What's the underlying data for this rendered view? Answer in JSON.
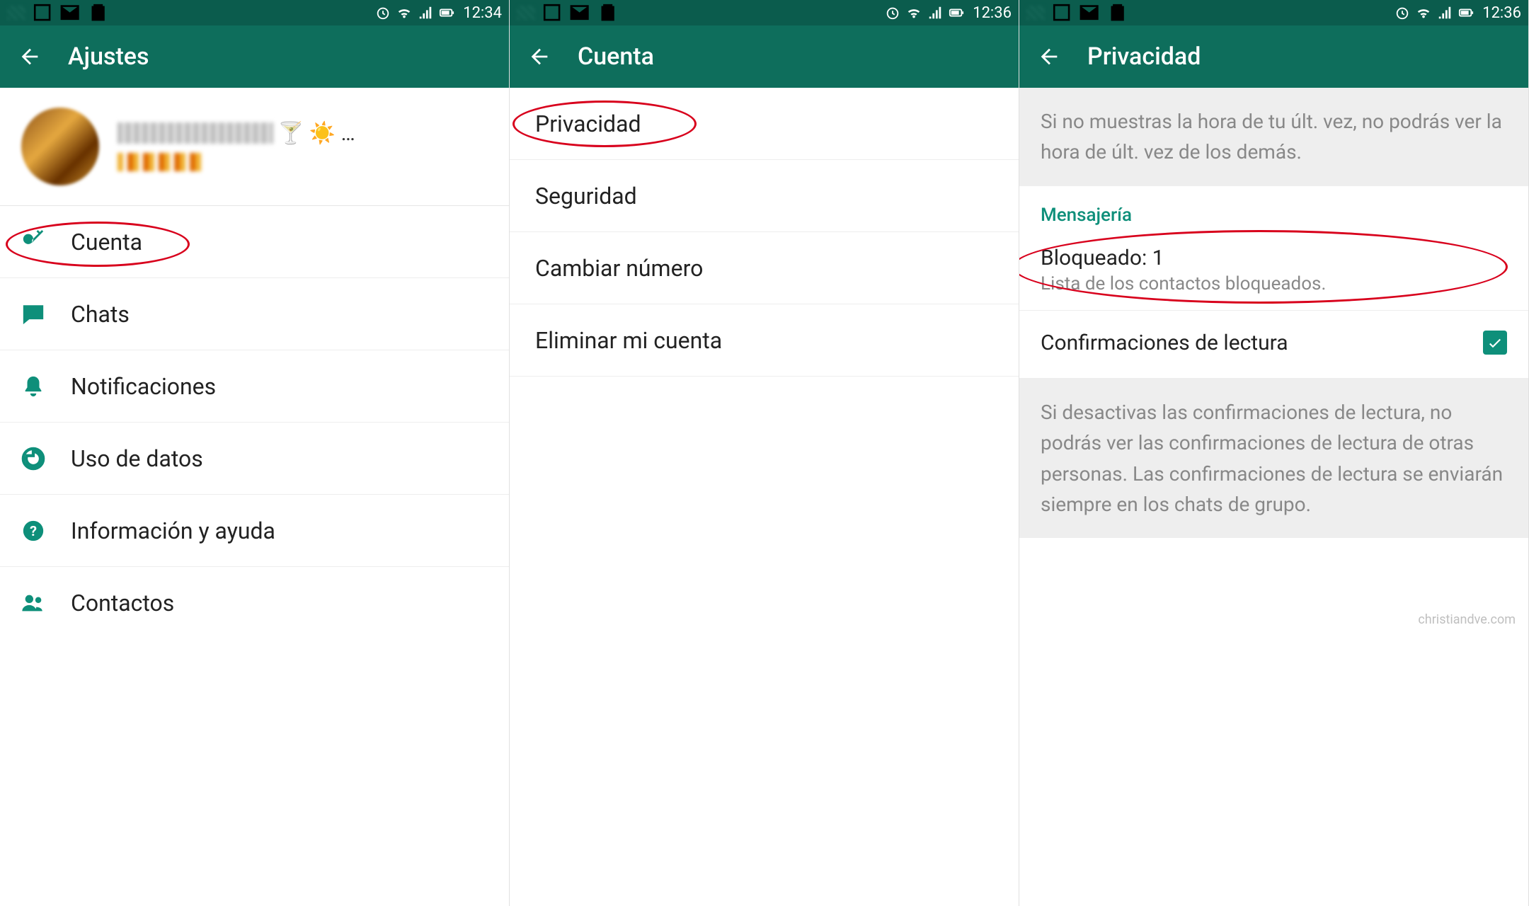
{
  "colors": {
    "brand": "#0e6e5c",
    "accent": "#0e8f7a",
    "annotation": "#d8001c"
  },
  "watermark": "christiandve.com",
  "screens": [
    {
      "status_time": "12:34",
      "appbar_title": "Ajustes",
      "profile": {
        "name_emojis": "🍸 ☀️ …"
      },
      "rows": [
        {
          "icon": "key",
          "label": "Cuenta"
        },
        {
          "icon": "chat",
          "label": "Chats"
        },
        {
          "icon": "bell",
          "label": "Notificaciones"
        },
        {
          "icon": "data",
          "label": "Uso de datos"
        },
        {
          "icon": "help",
          "label": "Información y ayuda"
        },
        {
          "icon": "people",
          "label": "Contactos"
        }
      ]
    },
    {
      "status_time": "12:36",
      "appbar_title": "Cuenta",
      "rows": [
        {
          "label": "Privacidad"
        },
        {
          "label": "Seguridad"
        },
        {
          "label": "Cambiar número"
        },
        {
          "label": "Eliminar mi cuenta"
        }
      ]
    },
    {
      "status_time": "12:36",
      "appbar_title": "Privacidad",
      "info_top": "Si no muestras la hora de tu últ. vez, no podrás ver la hora de últ. vez de los demás.",
      "section_title": "Mensajería",
      "blocked": {
        "title": "Bloqueado: 1",
        "subtitle": "Lista de los contactos bloqueados."
      },
      "read_receipts_label": "Confirmaciones de lectura",
      "read_receipts_checked": true,
      "info_bottom": "Si desactivas las confirmaciones de lectura, no podrás ver las confirmaciones de lectura de otras personas. Las confirmaciones de lectura se enviarán siempre en los chats de grupo."
    }
  ]
}
